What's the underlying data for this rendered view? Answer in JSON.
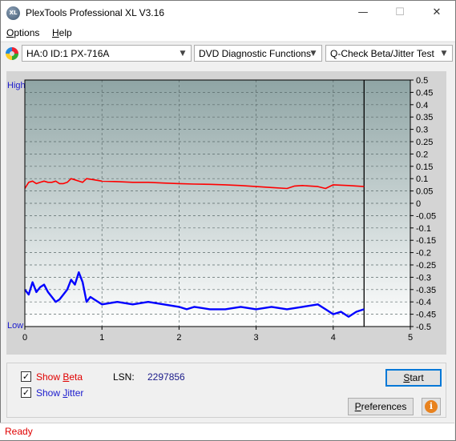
{
  "window": {
    "title": "PlexTools Professional XL V3.16",
    "icon_text": "XL"
  },
  "menu": [
    {
      "first": "O",
      "rest": "ptions"
    },
    {
      "first": "H",
      "rest": "elp"
    }
  ],
  "toolbar": {
    "drive": "HA:0 ID:1  PX-716A",
    "function": "DVD Diagnostic Functions",
    "test": "Q-Check Beta/Jitter Test"
  },
  "controls": {
    "show_beta": {
      "prefix": "Show ",
      "underline": "B",
      "suffix": "eta",
      "checked": true,
      "color": "#e00000"
    },
    "show_jitter": {
      "prefix": "Show ",
      "underline": "J",
      "suffix": "itter",
      "checked": true,
      "color": "#1a1acd"
    },
    "lsn_label": "LSN:",
    "lsn_value": "2297856",
    "start_first": "S",
    "start_rest": "tart",
    "pref_first": "P",
    "pref_rest": "references",
    "info_glyph": "i"
  },
  "status": "Ready",
  "chart_data": {
    "type": "line",
    "title": "",
    "x_ticks": [
      "0",
      "1",
      "2",
      "3",
      "4",
      "5"
    ],
    "xlim": [
      0,
      5
    ],
    "y_left_labels": {
      "top": "High",
      "bottom": "Low"
    },
    "y_right_ticks": [
      "0.5",
      "0.45",
      "0.4",
      "0.35",
      "0.3",
      "0.25",
      "0.2",
      "0.15",
      "0.1",
      "0.05",
      "0",
      "-0.05",
      "-0.1",
      "-0.15",
      "-0.2",
      "-0.25",
      "-0.3",
      "-0.35",
      "-0.4",
      "-0.45",
      "-0.5"
    ],
    "ylim": [
      -0.5,
      0.5
    ],
    "end_marker_x": 4.4,
    "grid": true,
    "colors": {
      "beta": "#ff0000",
      "jitter": "#0000ff",
      "plot_top": "#8fa5a5",
      "plot_bottom": "#ffffff"
    },
    "series": [
      {
        "name": "Beta",
        "x": [
          0,
          0.05,
          0.1,
          0.15,
          0.2,
          0.25,
          0.3,
          0.35,
          0.4,
          0.45,
          0.5,
          0.55,
          0.6,
          0.65,
          0.7,
          0.75,
          0.8,
          0.9,
          1.0,
          1.2,
          1.4,
          1.6,
          1.8,
          2.0,
          2.2,
          2.4,
          2.6,
          2.8,
          3.0,
          3.2,
          3.4,
          3.5,
          3.6,
          3.8,
          3.9,
          4.0,
          4.2,
          4.4
        ],
        "y": [
          0.06,
          0.085,
          0.09,
          0.08,
          0.085,
          0.09,
          0.085,
          0.085,
          0.09,
          0.08,
          0.08,
          0.085,
          0.1,
          0.095,
          0.09,
          0.085,
          0.1,
          0.095,
          0.09,
          0.088,
          0.085,
          0.085,
          0.082,
          0.08,
          0.078,
          0.077,
          0.075,
          0.072,
          0.068,
          0.064,
          0.06,
          0.07,
          0.072,
          0.068,
          0.06,
          0.075,
          0.072,
          0.068
        ]
      },
      {
        "name": "Jitter",
        "x": [
          0,
          0.05,
          0.1,
          0.15,
          0.2,
          0.25,
          0.3,
          0.35,
          0.4,
          0.45,
          0.5,
          0.55,
          0.6,
          0.65,
          0.7,
          0.75,
          0.8,
          0.85,
          0.9,
          1.0,
          1.2,
          1.4,
          1.6,
          1.8,
          2.0,
          2.1,
          2.2,
          2.4,
          2.6,
          2.8,
          3.0,
          3.2,
          3.4,
          3.6,
          3.8,
          3.9,
          4.0,
          4.1,
          4.2,
          4.3,
          4.4
        ],
        "y": [
          -0.35,
          -0.37,
          -0.32,
          -0.36,
          -0.34,
          -0.33,
          -0.36,
          -0.38,
          -0.4,
          -0.39,
          -0.37,
          -0.35,
          -0.31,
          -0.33,
          -0.28,
          -0.32,
          -0.4,
          -0.38,
          -0.39,
          -0.41,
          -0.4,
          -0.41,
          -0.4,
          -0.41,
          -0.42,
          -0.43,
          -0.42,
          -0.43,
          -0.43,
          -0.42,
          -0.43,
          -0.42,
          -0.43,
          -0.42,
          -0.41,
          -0.43,
          -0.45,
          -0.44,
          -0.46,
          -0.44,
          -0.43
        ]
      }
    ]
  }
}
